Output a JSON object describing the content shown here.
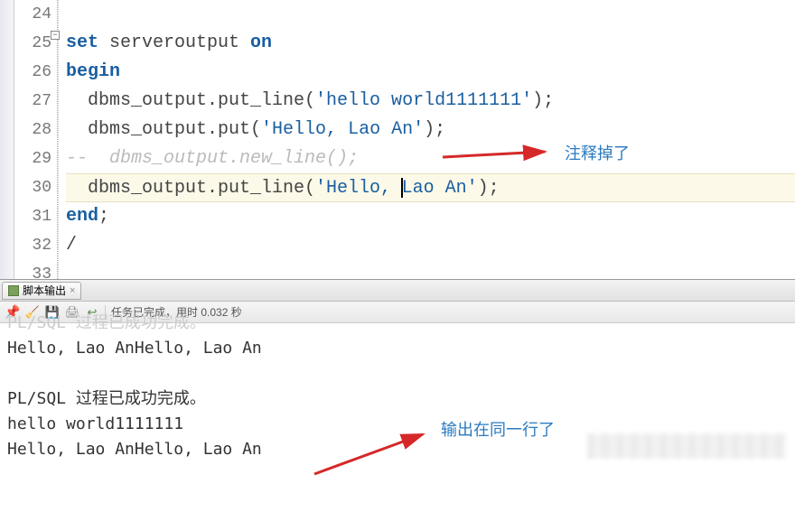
{
  "editor": {
    "lines": [
      {
        "n": 24,
        "frags": []
      },
      {
        "n": 25,
        "frags": [
          {
            "t": "set",
            "c": "kw"
          },
          {
            "t": " serveroutput ",
            "c": "ident"
          },
          {
            "t": "on",
            "c": "kw"
          }
        ]
      },
      {
        "n": 26,
        "frags": [
          {
            "t": "begin",
            "c": "kw"
          }
        ],
        "fold": true
      },
      {
        "n": 27,
        "frags": [
          {
            "t": "  dbms_output.put_line(",
            "c": "ident"
          },
          {
            "t": "'hello world1111111'",
            "c": "str"
          },
          {
            "t": ");",
            "c": "punct"
          }
        ]
      },
      {
        "n": 28,
        "frags": [
          {
            "t": "  dbms_output.put(",
            "c": "ident"
          },
          {
            "t": "'Hello, Lao An'",
            "c": "str"
          },
          {
            "t": ");",
            "c": "punct"
          }
        ]
      },
      {
        "n": 29,
        "frags": [
          {
            "t": "--  dbms_output.new_line();",
            "c": "comment-code"
          }
        ]
      },
      {
        "n": 30,
        "frags": [
          {
            "t": "  dbms_output.put_line(",
            "c": "ident"
          },
          {
            "t": "'Hello, ",
            "c": "str"
          },
          {
            "t": "|",
            "c": "cursor"
          },
          {
            "t": "Lao An'",
            "c": "str"
          },
          {
            "t": ");",
            "c": "punct"
          }
        ],
        "cursor": true
      },
      {
        "n": 31,
        "frags": [
          {
            "t": "end",
            "c": "kw"
          },
          {
            "t": ";",
            "c": "punct"
          }
        ]
      },
      {
        "n": 32,
        "frags": [
          {
            "t": "/",
            "c": "ident"
          }
        ]
      },
      {
        "n": 33,
        "frags": []
      }
    ]
  },
  "annotations": {
    "top_label": "注释掉了",
    "bottom_label": "输出在同一行了"
  },
  "outputPanel": {
    "tab_label": "脚本输出",
    "status": "任务已完成，用时 0.032 秒",
    "lines": [
      "Hello, Lao AnHello, Lao An",
      "",
      "PL/SQL 过程已成功完成。",
      "hello world1111111",
      "Hello, Lao AnHello, Lao An"
    ],
    "faded_line": "PL/SQL 过程已成功完成。"
  }
}
